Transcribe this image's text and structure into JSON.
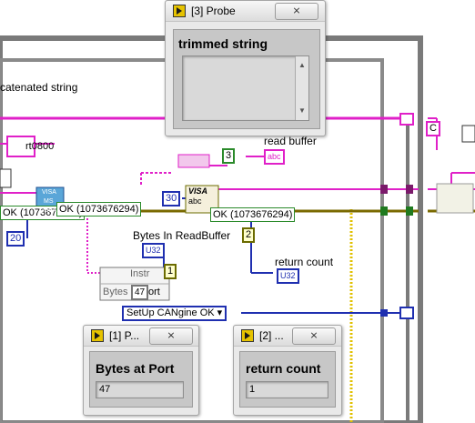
{
  "probes": [
    {
      "title": "[3] Probe",
      "close": "⨯",
      "panel_title": "trimmed string",
      "value": ""
    },
    {
      "title": "[1] P...",
      "close": "⨯",
      "panel_title": "Bytes at Port",
      "value": "47"
    },
    {
      "title": "[2] ...",
      "close": "⨯",
      "panel_title": "return count",
      "value": "1"
    }
  ],
  "labels": {
    "concatenated_string": "catenated string",
    "read_buffer": "read buffer",
    "bytes_in_readbuffer": "Bytes In ReadBuffer",
    "return_count": "return count",
    "rt0800": "rt0800"
  },
  "wire_labels": {
    "ok_left": "OK (1073676294)",
    "ok_mid": "OK (1073676294)",
    "ok_right": "OK (1073676294)"
  },
  "constants": {
    "three": "3",
    "thirty": "30",
    "twenty": "20",
    "two": "2",
    "one": "1",
    "forty_seven": "47",
    "u32_a": "U32",
    "u32_b": "U32",
    "abc": "abc",
    "c": "C"
  },
  "enum": {
    "value": "SetUp CANgine OK"
  },
  "property_node": {
    "instr": "Instr",
    "bytes": "Bytes",
    "port": "ort"
  },
  "visa_read": {
    "line1": "VISA",
    "line2": "abc"
  },
  "visa_clear": {
    "line1": "VISA",
    "line2": "MS",
    "line3": "DELA"
  },
  "colors": {
    "string_wire": "#e020c8",
    "error_wire": "#7a6a00",
    "int_wire": "#1f2fb0",
    "frame": "#7a7a7a"
  }
}
